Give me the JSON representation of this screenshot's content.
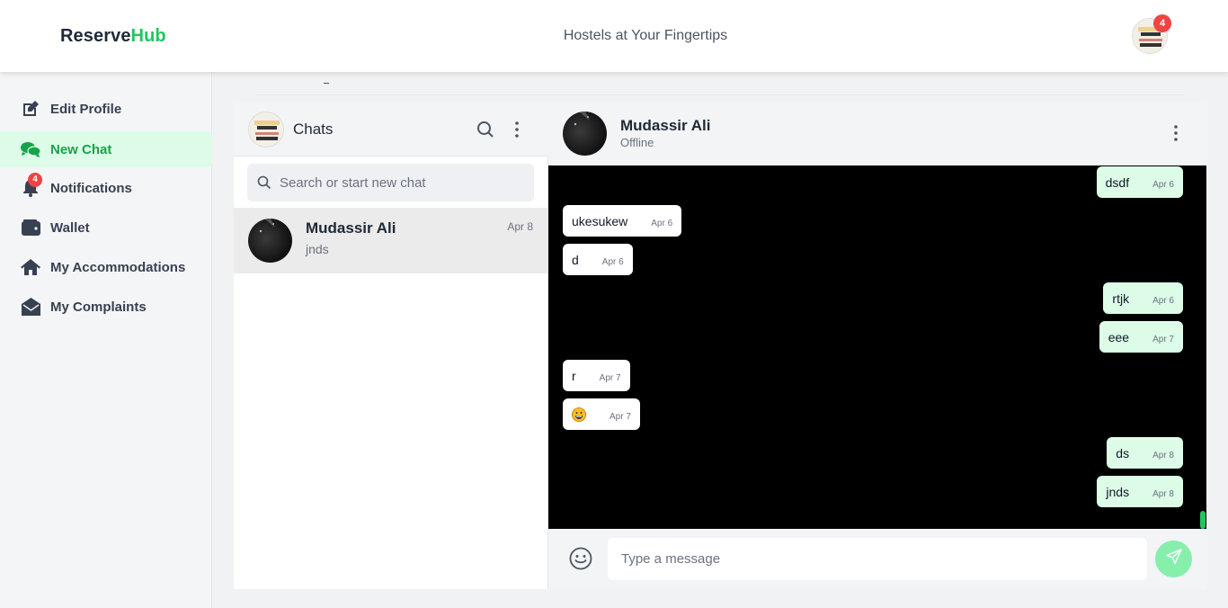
{
  "header": {
    "brand_part1": "Reserve",
    "brand_part2": "Hub",
    "tagline": "Hostels at Your Fingertips",
    "notification_count": "4"
  },
  "sidebar": {
    "items": [
      {
        "label": "Edit Profile",
        "icon": "edit-icon"
      },
      {
        "label": "New Chat",
        "icon": "chat-bubbles-icon",
        "active": true
      },
      {
        "label": "Notifications",
        "icon": "bell-icon",
        "badge": "4"
      },
      {
        "label": "Wallet",
        "icon": "wallet-icon"
      },
      {
        "label": "My Accommodations",
        "icon": "home-icon"
      },
      {
        "label": "My Complaints",
        "icon": "envelope-open-icon"
      }
    ]
  },
  "chat_list": {
    "title": "Chats",
    "search_placeholder": "Search or start new chat",
    "conversations": [
      {
        "name": "Mudassir Ali",
        "date": "Apr 8",
        "last_message": "jnds"
      }
    ]
  },
  "chat_window": {
    "contact_name": "Mudassir Ali",
    "status": "Offline",
    "input_placeholder": "Type a message",
    "messages": [
      {
        "dir": "out",
        "text": "dsdf",
        "date": "Apr 6"
      },
      {
        "dir": "in",
        "text": "ukesukew",
        "date": "Apr 6"
      },
      {
        "dir": "in",
        "text": "d",
        "date": "Apr 6"
      },
      {
        "dir": "out",
        "text": "rtjk",
        "date": "Apr 6"
      },
      {
        "dir": "out",
        "text": "eee",
        "date": "Apr 7"
      },
      {
        "dir": "in",
        "text": "r",
        "date": "Apr 7"
      },
      {
        "dir": "in",
        "text": "",
        "emoji": "grinning-face",
        "date": "Apr 7"
      },
      {
        "dir": "out",
        "text": "ds",
        "date": "Apr 8"
      },
      {
        "dir": "out",
        "text": "jnds",
        "date": "Apr 8"
      }
    ]
  },
  "colors": {
    "brand_green": "#22c55e",
    "active_bg": "#dcfce7",
    "badge_red": "#ef4444",
    "outgoing_bubble": "#dcfce7",
    "chat_bg": "#000000"
  }
}
